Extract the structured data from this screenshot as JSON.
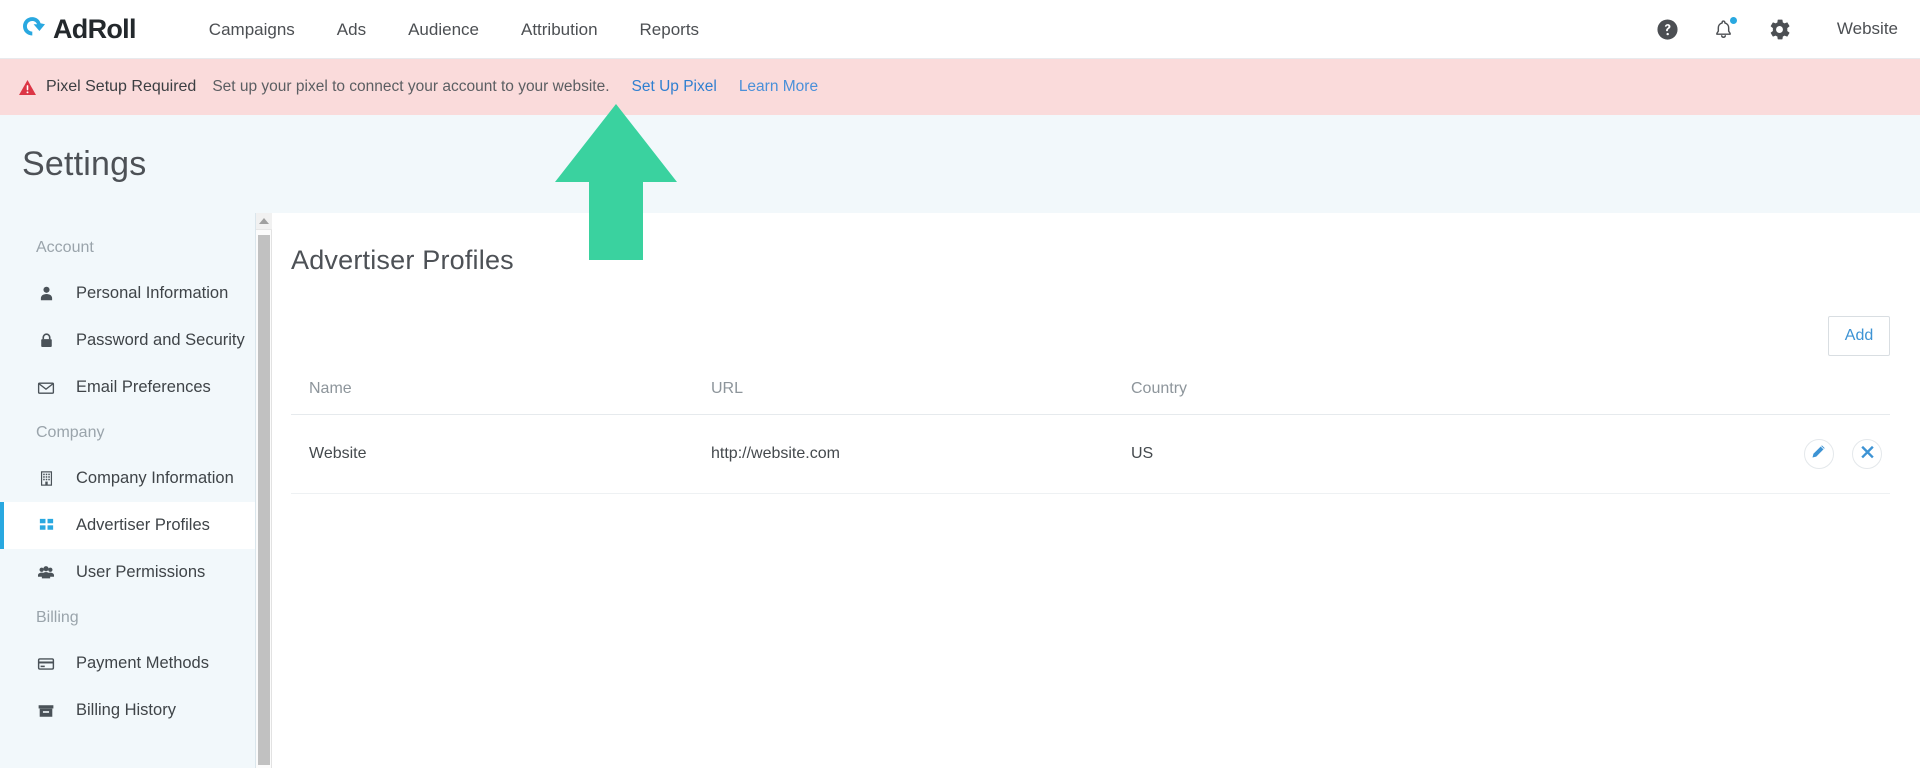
{
  "brand": {
    "name": "AdRoll",
    "logo_icon": "adroll-swirl-logo",
    "accent_blue": "#29a8e0"
  },
  "topnav": {
    "items": [
      {
        "label": "Campaigns",
        "name": "campaigns"
      },
      {
        "label": "Ads",
        "name": "ads"
      },
      {
        "label": "Audience",
        "name": "audience"
      },
      {
        "label": "Attribution",
        "name": "attribution"
      },
      {
        "label": "Reports",
        "name": "reports"
      }
    ],
    "right": {
      "help_icon": "help-circle-icon",
      "notifications_icon": "bell-icon",
      "notifications_has_unread": true,
      "settings_icon": "gear-icon",
      "account_label": "Website"
    }
  },
  "alert": {
    "icon": "warning-triangle-icon",
    "title": "Pixel Setup Required",
    "message": "Set up your pixel to connect your account to your website.",
    "primary_link": "Set Up Pixel",
    "secondary_link": "Learn More",
    "background_color": "#fadbdb",
    "icon_color": "#dc3545"
  },
  "page": {
    "title": "Settings"
  },
  "sidebar": {
    "groups": [
      {
        "label": "Account",
        "items": [
          {
            "label": "Personal Information",
            "icon": "user-icon",
            "active": false
          },
          {
            "label": "Password and Security",
            "icon": "lock-icon",
            "active": false
          },
          {
            "label": "Email Preferences",
            "icon": "envelope-icon",
            "active": false
          }
        ]
      },
      {
        "label": "Company",
        "items": [
          {
            "label": "Company Information",
            "icon": "building-icon",
            "active": false
          },
          {
            "label": "Advertiser Profiles",
            "icon": "grid-squares-icon",
            "active": true
          },
          {
            "label": "User Permissions",
            "icon": "users-group-icon",
            "active": false
          }
        ]
      },
      {
        "label": "Billing",
        "items": [
          {
            "label": "Payment Methods",
            "icon": "credit-card-icon",
            "active": false
          },
          {
            "label": "Billing History",
            "icon": "archive-box-icon",
            "active": false
          }
        ]
      }
    ],
    "scrollbar": {
      "up_arrow_icon": "scroll-up-arrow-icon"
    }
  },
  "main": {
    "title": "Advertiser Profiles",
    "add_button_label": "Add",
    "table": {
      "columns": [
        "Name",
        "URL",
        "Country"
      ],
      "rows": [
        {
          "name": "Website",
          "url": "http://website.com",
          "country": "US",
          "actions": [
            {
              "icon": "pencil-edit-icon",
              "name": "edit-profile-button"
            },
            {
              "icon": "close-x-icon",
              "name": "delete-profile-button"
            }
          ]
        }
      ]
    }
  },
  "annotation": {
    "arrow_icon": "up-arrow-annotation",
    "color": "#3ad29f",
    "points_to": "Set Up Pixel"
  }
}
